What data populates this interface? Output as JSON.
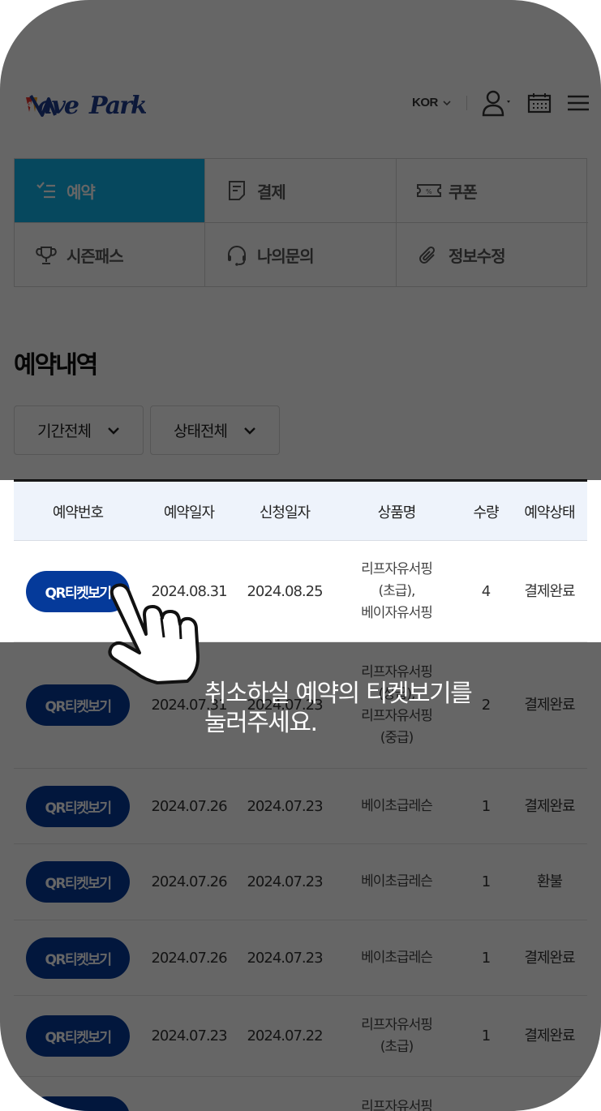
{
  "header": {
    "logo_text": "WavePark",
    "language": "KOR"
  },
  "menu": [
    {
      "label": "예약",
      "icon": "checklist-icon",
      "active": true
    },
    {
      "label": "결제",
      "icon": "receipt-icon",
      "active": false
    },
    {
      "label": "쿠폰",
      "icon": "coupon-icon",
      "active": false
    },
    {
      "label": "시즌패스",
      "icon": "trophy-icon",
      "active": false
    },
    {
      "label": "나의문의",
      "icon": "headset-icon",
      "active": false
    },
    {
      "label": "정보수정",
      "icon": "paperclip-icon",
      "active": false
    }
  ],
  "section_title": "예약내역",
  "filters": {
    "period": "기간전체",
    "status": "상태전체"
  },
  "table": {
    "headers": [
      "예약번호",
      "예약일자",
      "신청일자",
      "상품명",
      "수량",
      "예약상태"
    ],
    "qr_button_label": "QR티켓보기",
    "rows": [
      {
        "reserve_date": "2024.08.31",
        "apply_date": "2024.08.25",
        "product": "리프자유서핑\n(초급),\n베이자유서핑",
        "qty": "4",
        "status": "결제완료"
      },
      {
        "reserve_date": "2024.07.31",
        "apply_date": "2024.07.23",
        "product": "리프자유서핑\n(상급),\n리프자유서핑\n(중급)",
        "qty": "2",
        "status": "결제완료"
      },
      {
        "reserve_date": "2024.07.26",
        "apply_date": "2024.07.23",
        "product": "베이초급레슨",
        "qty": "1",
        "status": "결제완료"
      },
      {
        "reserve_date": "2024.07.26",
        "apply_date": "2024.07.23",
        "product": "베이초급레슨",
        "qty": "1",
        "status": "환불"
      },
      {
        "reserve_date": "2024.07.26",
        "apply_date": "2024.07.23",
        "product": "베이초급레슨",
        "qty": "1",
        "status": "결제완료"
      },
      {
        "reserve_date": "2024.07.23",
        "apply_date": "2024.07.22",
        "product": "리프자유서핑\n(초급)",
        "qty": "1",
        "status": "결제완료"
      },
      {
        "reserve_date": "",
        "apply_date": "",
        "product": "리프자유서핑",
        "qty": "",
        "status": ""
      }
    ]
  },
  "tutorial": {
    "message": "취소하실 예약의 티켓보기를\n눌러주세요."
  },
  "colors": {
    "accent": "#11b5ea",
    "qr_button": "#053a9a",
    "overlay": "rgba(0,0,0,0.6)"
  }
}
